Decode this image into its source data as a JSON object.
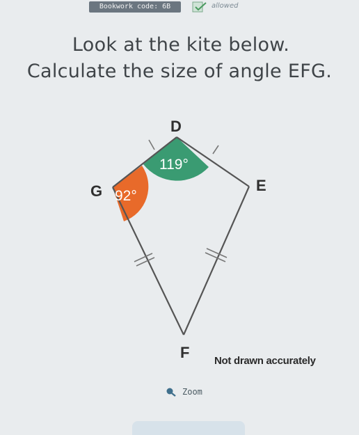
{
  "header": {
    "bookwork_code": "Bookwork code: 6B",
    "calculator_status": "allowed"
  },
  "question": {
    "line1": "Look at the kite below.",
    "line2": "Calculate the size of angle EFG."
  },
  "diagram": {
    "vertices": {
      "D": "D",
      "E": "E",
      "F": "F",
      "G": "G"
    },
    "angles": {
      "D": "119°",
      "G": "92°"
    },
    "colors": {
      "angle_D": "#3a9b72",
      "angle_G": "#e86a2a",
      "lines": "#555555"
    }
  },
  "footer": {
    "note": "Not drawn accurately",
    "zoom_label": "Zoom"
  }
}
